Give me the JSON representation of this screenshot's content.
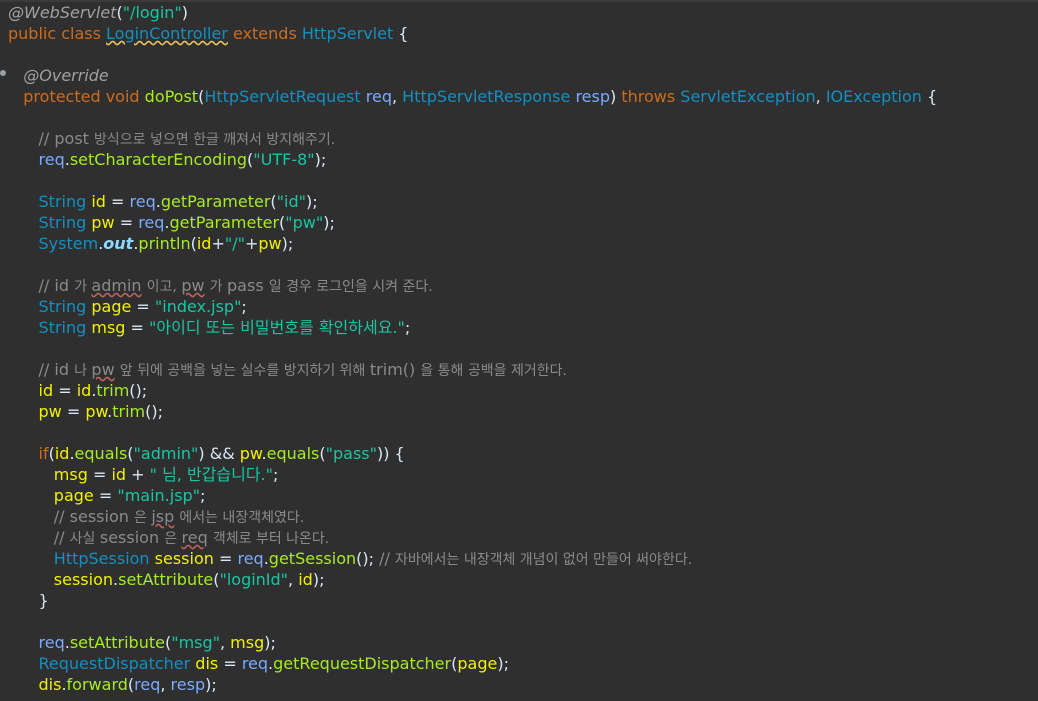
{
  "editor": {
    "lines": [
      [
        [
          "ann",
          "@WebServlet"
        ],
        [
          "plain",
          "("
        ],
        [
          "str",
          "\"/login\""
        ],
        [
          "plain",
          ")"
        ]
      ],
      [
        [
          "kw",
          "public class "
        ],
        [
          "wclass",
          "LoginController"
        ],
        [
          "plain",
          " "
        ],
        [
          "kw",
          "extends "
        ],
        [
          "cls",
          "HttpServlet"
        ],
        [
          "plain",
          " {"
        ]
      ],
      [],
      [
        [
          "plain",
          "   "
        ],
        [
          "ann",
          "@Override"
        ]
      ],
      [
        [
          "plain",
          "   "
        ],
        [
          "kw",
          "protected void "
        ],
        [
          "fnc",
          "doPost"
        ],
        [
          "plain",
          "("
        ],
        [
          "cls",
          "HttpServletRequest"
        ],
        [
          "plain",
          " "
        ],
        [
          "pv",
          "req"
        ],
        [
          "plain",
          ", "
        ],
        [
          "cls",
          "HttpServletResponse"
        ],
        [
          "plain",
          " "
        ],
        [
          "pv",
          "resp"
        ],
        [
          "plain",
          ") "
        ],
        [
          "kw",
          "throws "
        ],
        [
          "cls",
          "ServletException"
        ],
        [
          "plain",
          ", "
        ],
        [
          "cls",
          "IOException"
        ],
        [
          "plain",
          " {"
        ]
      ],
      [],
      [
        [
          "plain",
          "      "
        ],
        [
          "cmt",
          "// post "
        ],
        [
          "cmtkr",
          "방식으로 넣으면 한글 깨져서 방지해주기."
        ]
      ],
      [
        [
          "plain",
          "      "
        ],
        [
          "pv",
          "req"
        ],
        [
          "plain",
          "."
        ],
        [
          "method",
          "setCharacterEncoding"
        ],
        [
          "plain",
          "("
        ],
        [
          "str",
          "\"UTF-8\""
        ],
        [
          "plain",
          ");"
        ]
      ],
      [],
      [
        [
          "plain",
          "      "
        ],
        [
          "cls",
          "String"
        ],
        [
          "plain",
          " "
        ],
        [
          "var",
          "id"
        ],
        [
          "plain",
          " = "
        ],
        [
          "pv",
          "req"
        ],
        [
          "plain",
          "."
        ],
        [
          "method",
          "getParameter"
        ],
        [
          "plain",
          "("
        ],
        [
          "str",
          "\"id\""
        ],
        [
          "plain",
          ");"
        ]
      ],
      [
        [
          "plain",
          "      "
        ],
        [
          "cls",
          "String"
        ],
        [
          "plain",
          " "
        ],
        [
          "var",
          "pw"
        ],
        [
          "plain",
          " = "
        ],
        [
          "pv",
          "req"
        ],
        [
          "plain",
          "."
        ],
        [
          "method",
          "getParameter"
        ],
        [
          "plain",
          "("
        ],
        [
          "str",
          "\"pw\""
        ],
        [
          "plain",
          ");"
        ]
      ],
      [
        [
          "plain",
          "      "
        ],
        [
          "cls",
          "System"
        ],
        [
          "plain",
          "."
        ],
        [
          "static",
          "out"
        ],
        [
          "plain",
          "."
        ],
        [
          "method",
          "println"
        ],
        [
          "plain",
          "("
        ],
        [
          "var",
          "id"
        ],
        [
          "plain",
          "+"
        ],
        [
          "str",
          "\"/\""
        ],
        [
          "plain",
          "+"
        ],
        [
          "var",
          "pw"
        ],
        [
          "plain",
          ");"
        ]
      ],
      [],
      [
        [
          "plain",
          "      "
        ],
        [
          "cmt",
          "// id "
        ],
        [
          "cmtkr",
          "가 "
        ],
        [
          "cmtw",
          "admin"
        ],
        [
          "cmt",
          " "
        ],
        [
          "cmtkr",
          "이고, "
        ],
        [
          "cmtw",
          "pw"
        ],
        [
          "cmt",
          " "
        ],
        [
          "cmtkr",
          "가 "
        ],
        [
          "cmt",
          "pass "
        ],
        [
          "cmtkr",
          "일 경우 로그인을 시켜 준다."
        ]
      ],
      [
        [
          "plain",
          "      "
        ],
        [
          "cls",
          "String"
        ],
        [
          "plain",
          " "
        ],
        [
          "var",
          "page"
        ],
        [
          "plain",
          " = "
        ],
        [
          "str",
          "\"index.jsp\""
        ],
        [
          "plain",
          ";"
        ]
      ],
      [
        [
          "plain",
          "      "
        ],
        [
          "cls",
          "String"
        ],
        [
          "plain",
          " "
        ],
        [
          "var",
          "msg"
        ],
        [
          "plain",
          " = "
        ],
        [
          "str",
          "\"아이디 또는 비밀번호를 확인하세요.\""
        ],
        [
          "plain",
          ";"
        ]
      ],
      [],
      [
        [
          "plain",
          "      "
        ],
        [
          "cmt",
          "// id "
        ],
        [
          "cmtkr",
          "나 "
        ],
        [
          "cmtw",
          "pw"
        ],
        [
          "cmt",
          " "
        ],
        [
          "cmtkr",
          "앞 뒤에 공백을 넣는 실수를 방지하기 위해 "
        ],
        [
          "cmt",
          "trim() "
        ],
        [
          "cmtkr",
          "을 통해 공백을 제거한다."
        ]
      ],
      [
        [
          "plain",
          "      "
        ],
        [
          "var",
          "id"
        ],
        [
          "plain",
          " = "
        ],
        [
          "var",
          "id"
        ],
        [
          "plain",
          "."
        ],
        [
          "method",
          "trim"
        ],
        [
          "plain",
          "();"
        ]
      ],
      [
        [
          "plain",
          "      "
        ],
        [
          "var",
          "pw"
        ],
        [
          "plain",
          " = "
        ],
        [
          "var",
          "pw"
        ],
        [
          "plain",
          "."
        ],
        [
          "method",
          "trim"
        ],
        [
          "plain",
          "();"
        ]
      ],
      [],
      [
        [
          "plain",
          "      "
        ],
        [
          "kw",
          "if"
        ],
        [
          "plain",
          "("
        ],
        [
          "var",
          "id"
        ],
        [
          "plain",
          "."
        ],
        [
          "method",
          "equals"
        ],
        [
          "plain",
          "("
        ],
        [
          "str",
          "\"admin\""
        ],
        [
          "plain",
          ") && "
        ],
        [
          "var",
          "pw"
        ],
        [
          "plain",
          "."
        ],
        [
          "method",
          "equals"
        ],
        [
          "plain",
          "("
        ],
        [
          "str",
          "\"pass\""
        ],
        [
          "plain",
          ")) {"
        ]
      ],
      [
        [
          "plain",
          "         "
        ],
        [
          "var",
          "msg"
        ],
        [
          "plain",
          " = "
        ],
        [
          "var",
          "id"
        ],
        [
          "plain",
          " + "
        ],
        [
          "str",
          "\" 님, 반갑습니다.\""
        ],
        [
          "plain",
          ";"
        ]
      ],
      [
        [
          "plain",
          "         "
        ],
        [
          "var",
          "page"
        ],
        [
          "plain",
          " = "
        ],
        [
          "str",
          "\"main.jsp\""
        ],
        [
          "plain",
          ";"
        ]
      ],
      [
        [
          "plain",
          "         "
        ],
        [
          "cmt",
          "// session "
        ],
        [
          "cmtkr",
          "은 "
        ],
        [
          "cmtw",
          "jsp"
        ],
        [
          "cmt",
          " "
        ],
        [
          "cmtkr",
          "에서는 내장객체였다."
        ]
      ],
      [
        [
          "plain",
          "         "
        ],
        [
          "cmt",
          "// "
        ],
        [
          "cmtkr",
          "사실 "
        ],
        [
          "cmt",
          "session "
        ],
        [
          "cmtkr",
          "은 "
        ],
        [
          "cmtw",
          "req"
        ],
        [
          "cmt",
          " "
        ],
        [
          "cmtkr",
          "객체로 부터 나온다."
        ]
      ],
      [
        [
          "plain",
          "         "
        ],
        [
          "cls",
          "HttpSession"
        ],
        [
          "plain",
          " "
        ],
        [
          "var",
          "session"
        ],
        [
          "plain",
          " = "
        ],
        [
          "pv",
          "req"
        ],
        [
          "plain",
          "."
        ],
        [
          "method",
          "getSession"
        ],
        [
          "plain",
          "(); "
        ],
        [
          "cmt",
          "// "
        ],
        [
          "cmtkr",
          "자바에서는 내장객체 개념이 없어 만들어 써야한다."
        ]
      ],
      [
        [
          "plain",
          "         "
        ],
        [
          "var",
          "session"
        ],
        [
          "plain",
          "."
        ],
        [
          "method",
          "setAttribute"
        ],
        [
          "plain",
          "("
        ],
        [
          "str",
          "\"loginId\""
        ],
        [
          "plain",
          ", "
        ],
        [
          "var",
          "id"
        ],
        [
          "plain",
          ");"
        ]
      ],
      [
        [
          "plain",
          "      }"
        ]
      ],
      [],
      [
        [
          "plain",
          "      "
        ],
        [
          "pv",
          "req"
        ],
        [
          "plain",
          "."
        ],
        [
          "method",
          "setAttribute"
        ],
        [
          "plain",
          "("
        ],
        [
          "str",
          "\"msg\""
        ],
        [
          "plain",
          ", "
        ],
        [
          "var",
          "msg"
        ],
        [
          "plain",
          ");"
        ]
      ],
      [
        [
          "plain",
          "      "
        ],
        [
          "cls",
          "RequestDispatcher"
        ],
        [
          "plain",
          " "
        ],
        [
          "var",
          "dis"
        ],
        [
          "plain",
          " = "
        ],
        [
          "pv",
          "req"
        ],
        [
          "plain",
          "."
        ],
        [
          "method",
          "getRequestDispatcher"
        ],
        [
          "plain",
          "("
        ],
        [
          "var",
          "page"
        ],
        [
          "plain",
          ");"
        ]
      ],
      [
        [
          "plain",
          "      "
        ],
        [
          "var",
          "dis"
        ],
        [
          "plain",
          "."
        ],
        [
          "method",
          "forward"
        ],
        [
          "plain",
          "("
        ],
        [
          "pv",
          "req"
        ],
        [
          "plain",
          ", "
        ],
        [
          "pv",
          "resp"
        ],
        [
          "plain",
          ");"
        ]
      ]
    ]
  }
}
